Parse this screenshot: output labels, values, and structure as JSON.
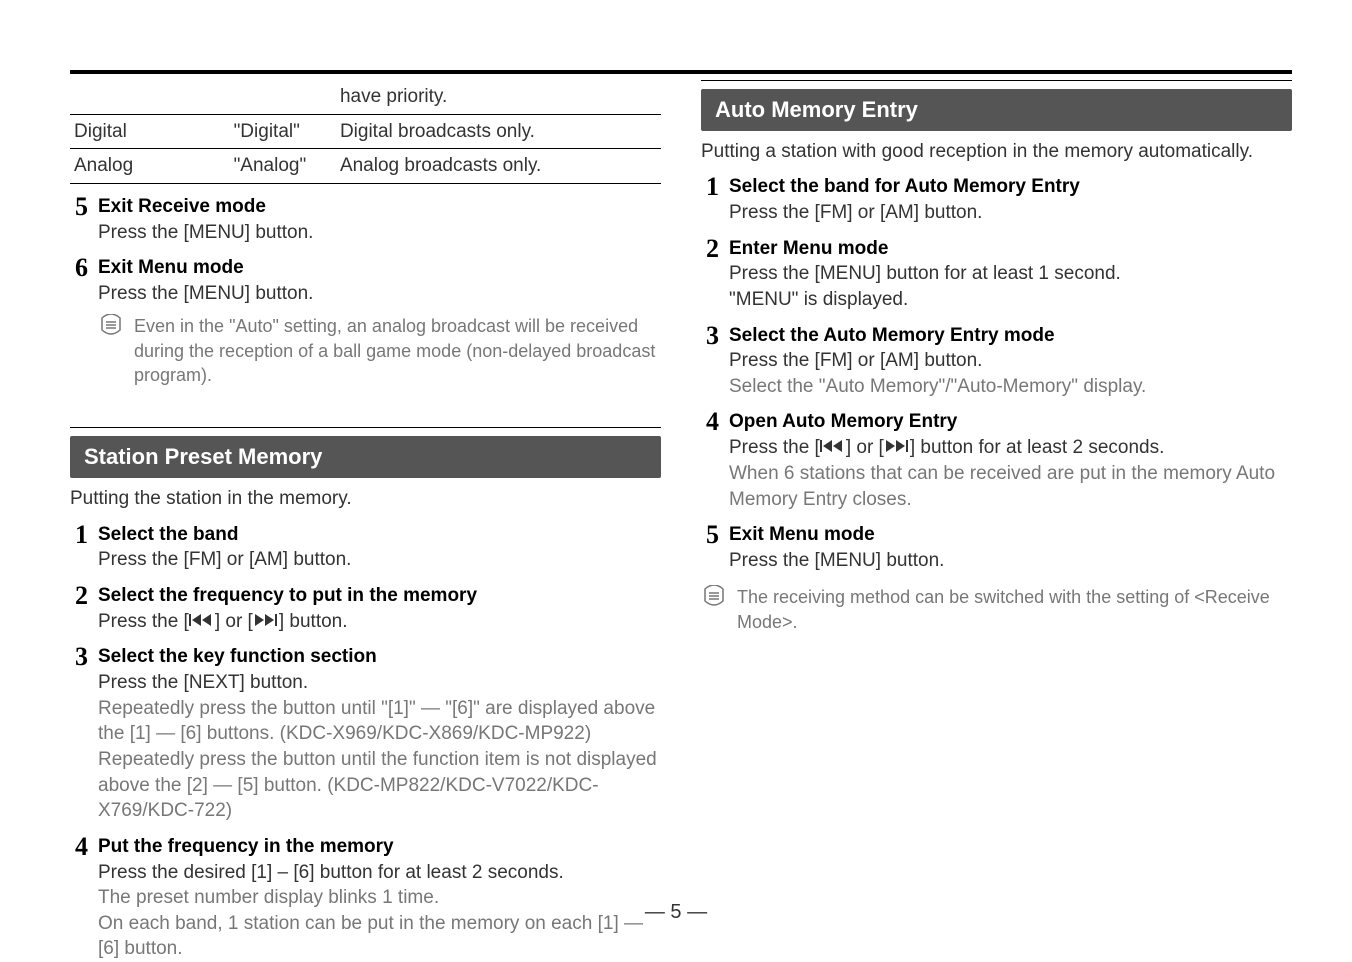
{
  "page_number": "— 5 —",
  "left": {
    "table": {
      "r1c1": "",
      "r1c2": "",
      "r1c3": "have priority.",
      "r2c1": "Digital",
      "r2c2": "\"Digital\"",
      "r2c3": "Digital broadcasts only.",
      "r3c1": "Analog",
      "r3c2": "\"Analog\"",
      "r3c3": "Analog broadcasts only."
    },
    "step5": {
      "num": "5",
      "h": "Exit Receive mode",
      "l1": "Press the [MENU] button."
    },
    "step6": {
      "num": "6",
      "h": "Exit Menu mode",
      "l1": "Press the [MENU] button."
    },
    "note1": "Even in the \"Auto\" setting, an analog broadcast will be received during the reception of a ball game mode (non-delayed broadcast program).",
    "preset": {
      "title": "Station Preset Memory",
      "intro": "Putting the station in the memory.",
      "s1": {
        "num": "1",
        "h": "Select the band",
        "l1": "Press the [FM] or [AM] button."
      },
      "s2": {
        "num": "2",
        "h": "Select the frequency to put in the memory",
        "l1a": "Press the [",
        "l1b": "] or [",
        "l1c": "] button."
      },
      "s3": {
        "num": "3",
        "h": "Select the key function section",
        "l1": "Press the [NEXT] button.",
        "l2": "Repeatedly press the button until \"[1]\" — \"[6]\" are displayed above the [1] — [6] buttons. (KDC-X969/KDC-X869/KDC-MP922)",
        "l3": "Repeatedly press the button until the function item is not displayed above the [2] — [5] button. (KDC-MP822/KDC-V7022/KDC-X769/KDC-722)"
      },
      "s4": {
        "num": "4",
        "h": "Put the frequency in the memory",
        "l1": "Press the desired [1] – [6] button for at least 2 seconds.",
        "l2": "The preset number display blinks 1 time.",
        "l3": "On each band, 1 station can be put in the memory on each [1] — [6] button."
      }
    }
  },
  "right": {
    "auto": {
      "title": "Auto Memory Entry",
      "intro": "Putting a station with good reception in the memory automatically.",
      "s1": {
        "num": "1",
        "h": "Select the band for Auto Memory Entry",
        "l1": "Press the [FM] or [AM] button."
      },
      "s2": {
        "num": "2",
        "h": "Enter Menu mode",
        "l1": "Press the [MENU] button for at least 1 second.",
        "l2": "\"MENU\" is displayed."
      },
      "s3": {
        "num": "3",
        "h": "Select the Auto Memory Entry mode",
        "l1": "Press the [FM] or [AM] button.",
        "l2": "Select the \"Auto Memory\"/\"Auto-Memory\" display."
      },
      "s4": {
        "num": "4",
        "h": "Open Auto Memory Entry",
        "l1a": "Press the [",
        "l1b": "] or [",
        "l1c": "] button for at least 2 seconds.",
        "l2": "When 6 stations that can be received are put in the memory Auto Memory Entry closes."
      },
      "s5": {
        "num": "5",
        "h": "Exit Menu mode",
        "l1": "Press the [MENU] button."
      }
    },
    "note": "The receiving method can be switched with the setting of <Receive Mode>."
  }
}
